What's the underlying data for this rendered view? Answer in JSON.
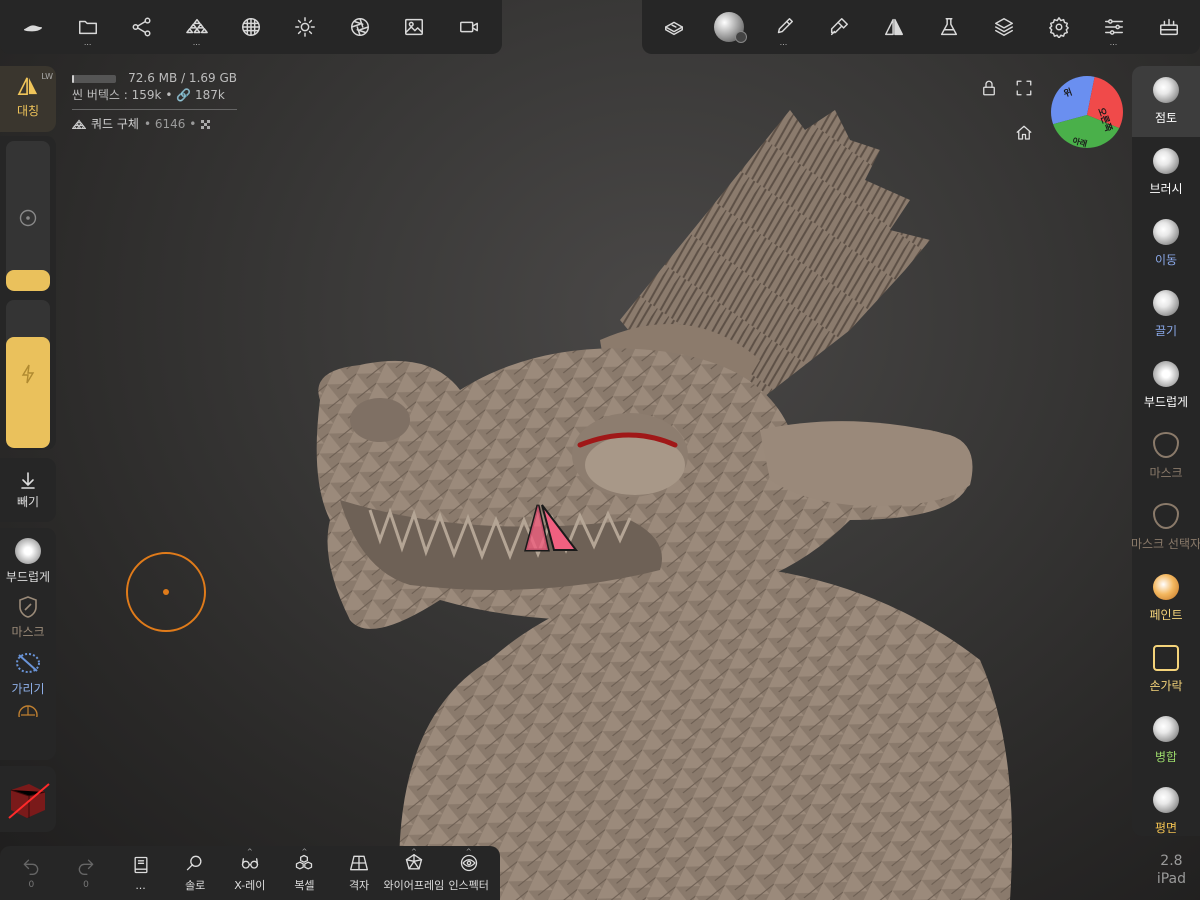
{
  "top_left_toolbar": [
    {
      "name": "project-logo-icon",
      "dots": ""
    },
    {
      "name": "files-icon",
      "dots": "..."
    },
    {
      "name": "scene-graph-icon",
      "dots": ""
    },
    {
      "name": "multiresolution-icon",
      "dots": "..."
    },
    {
      "name": "topology-icon",
      "dots": ""
    },
    {
      "name": "lighting-icon",
      "dots": ""
    },
    {
      "name": "post-process-icon",
      "dots": ""
    },
    {
      "name": "background-image-icon",
      "dots": ""
    },
    {
      "name": "camera-icon",
      "dots": ""
    }
  ],
  "top_right_toolbar": [
    {
      "name": "gizmo-icon",
      "dots": ""
    },
    {
      "name": "material-icon",
      "dots": ""
    },
    {
      "name": "painting-icon",
      "dots": "..."
    },
    {
      "name": "stroke-icon",
      "dots": ""
    },
    {
      "name": "symmetry-icon",
      "dots": ""
    },
    {
      "name": "experimental-icon",
      "dots": ""
    },
    {
      "name": "layers-icon",
      "dots": ""
    },
    {
      "name": "settings-icon",
      "dots": ""
    },
    {
      "name": "sliders-icon",
      "dots": "..."
    },
    {
      "name": "tools-icon",
      "dots": ""
    }
  ],
  "stats": {
    "memory": "72.6 MB / 1.69 GB",
    "memory_fraction": 0.043,
    "vertices": "씬 버텍스 : 159k • 🔗 187k",
    "mesh_name": "쿼드 구체",
    "mesh_count": "• 6146 •"
  },
  "left_panel": {
    "symmetry_label": "대칭",
    "symmetry_badge": "LW",
    "radius_fraction": 0.14,
    "intensity_fraction": 0.75,
    "subtract_label": "빼기",
    "smooth_label": "부드럽게",
    "mask_label": "마스크",
    "hide_label": "가리기"
  },
  "right_panel": [
    {
      "name": "clay",
      "label": "점토",
      "color": "#ffffff",
      "selected": true
    },
    {
      "name": "brush",
      "label": "브러시",
      "color": "#ffffff",
      "selected": false
    },
    {
      "name": "move",
      "label": "이동",
      "color": "#8aa8e8",
      "selected": false
    },
    {
      "name": "drag",
      "label": "끌기",
      "color": "#8aa8e8",
      "selected": false
    },
    {
      "name": "smooth",
      "label": "부드럽게",
      "color": "#ffffff",
      "selected": false
    },
    {
      "name": "mask",
      "label": "마스크",
      "color": "#8a7a6a",
      "selected": false
    },
    {
      "name": "mask-selector",
      "label": "마스크 선택자",
      "color": "#8a7a6a",
      "selected": false
    },
    {
      "name": "paint",
      "label": "페인트",
      "color": "#f4d37a",
      "selected": false
    },
    {
      "name": "finger",
      "label": "손가락",
      "color": "#f4d37a",
      "selected": false
    },
    {
      "name": "merge",
      "label": "병합",
      "color": "#9ad86a",
      "selected": false
    },
    {
      "name": "flatten",
      "label": "평면",
      "color": "#f0c050",
      "selected": false
    }
  ],
  "bottom_bar": {
    "undo_count": "0",
    "redo_count": "0",
    "more_label": "...",
    "solo_label": "솔로",
    "xray_label": "X-레이",
    "voxel_label": "복셀",
    "grid_label": "격자",
    "wireframe_label": "와이어프레임",
    "inspector_label": "인스펙터"
  },
  "view_cube": {
    "top_label": "위",
    "right_label": "오른쪽",
    "front_label": "앞",
    "bottom_label": "아래",
    "top_color": "#6a8ff0",
    "right_color": "#f04a4a",
    "front_color": "#4ab04a"
  },
  "version": {
    "number": "2.8",
    "device": "iPad"
  },
  "colors": {
    "accent": "#eac15c",
    "brush_cursor": "#e07b1a",
    "panel": "#262626"
  }
}
